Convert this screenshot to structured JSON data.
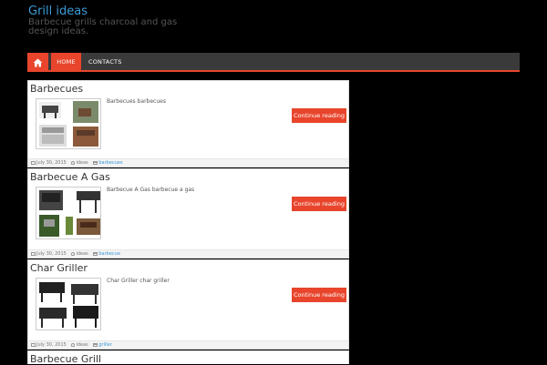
{
  "site": {
    "title": "Grill ideas",
    "description": "Barbecue grills charcoal and gas design ideas."
  },
  "nav": {
    "home_icon": "home-icon",
    "items": [
      "HOME",
      "CONTACTS"
    ]
  },
  "colors": {
    "accent": "#e8452c",
    "link": "#3a9bd6",
    "nav_bg": "#3a3a3a"
  },
  "posts": [
    {
      "title": "Barbecues",
      "excerpt": "Barbecues barbecues",
      "more": "Continue reading »",
      "date": "July 30, 2015",
      "author": "ideas",
      "category": "barbecues"
    },
    {
      "title": "Barbecue A Gas",
      "excerpt": "Barbecue A Gas barbecue a gas",
      "more": "Continue reading »",
      "date": "July 30, 2015",
      "author": "ideas",
      "category": "barbecue"
    },
    {
      "title": "Char Griller",
      "excerpt": "Char Griller char griller",
      "more": "Continue reading »",
      "date": "July 30, 2015",
      "author": "ideas",
      "category": "griller"
    },
    {
      "title": "Barbecue Grill"
    }
  ]
}
